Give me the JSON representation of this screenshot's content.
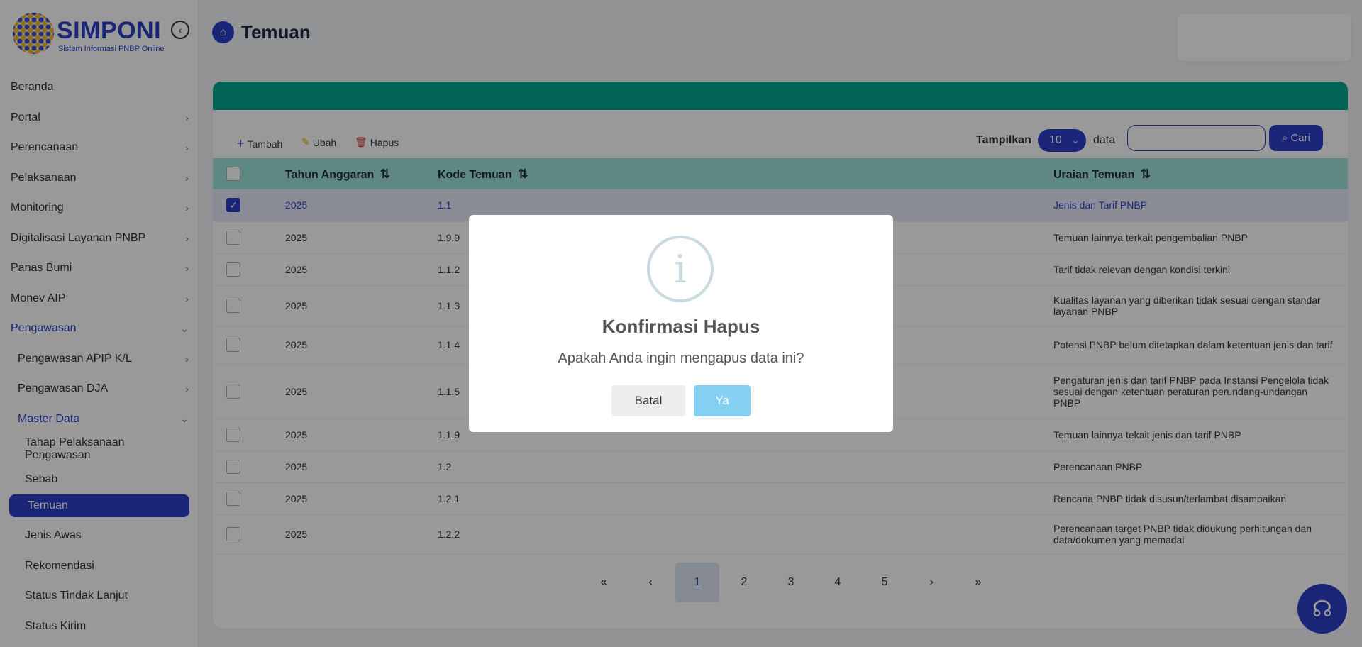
{
  "app": {
    "name": "SIMPONI",
    "subtitle": "Sistem Informasi PNBP Online"
  },
  "sidebar": {
    "items": [
      {
        "label": "Beranda",
        "chevron": ""
      },
      {
        "label": "Portal",
        "chevron": "›"
      },
      {
        "label": "Perencanaan",
        "chevron": "›"
      },
      {
        "label": "Pelaksanaan",
        "chevron": "›"
      },
      {
        "label": "Monitoring",
        "chevron": "›"
      },
      {
        "label": "Digitalisasi Layanan PNBP",
        "chevron": "›"
      },
      {
        "label": "Panas Bumi",
        "chevron": "›"
      },
      {
        "label": "Monev AIP",
        "chevron": "›"
      },
      {
        "label": "Pengawasan",
        "chevron": "⌄"
      },
      {
        "label": "Pengawasan APIP K/L",
        "chevron": "›"
      },
      {
        "label": "Pengawasan DJA",
        "chevron": "›"
      },
      {
        "label": "Master Data",
        "chevron": "⌄"
      },
      {
        "label": "Tahap Pelaksanaan Pengawasan",
        "chevron": ""
      },
      {
        "label": "Sebab",
        "chevron": ""
      },
      {
        "label": "Temuan",
        "chevron": ""
      },
      {
        "label": "Jenis Awas",
        "chevron": ""
      },
      {
        "label": "Rekomendasi",
        "chevron": ""
      },
      {
        "label": "Status Tindak Lanjut",
        "chevron": ""
      },
      {
        "label": "Status Kirim",
        "chevron": ""
      }
    ]
  },
  "page": {
    "title": "Temuan"
  },
  "toolbar": {
    "add_label": "Tambah",
    "edit_label": "Ubah",
    "delete_label": "Hapus",
    "show_label": "Tampilkan",
    "page_size": "10",
    "data_label": "data",
    "search_placeholder": "",
    "search_label": "Cari"
  },
  "table": {
    "columns": [
      "Tahun Anggaran",
      "Kode Temuan",
      "Uraian Temuan"
    ],
    "rows": [
      {
        "year": "2025",
        "code": "1.1",
        "desc": "Jenis dan Tarif PNBP",
        "checked": true
      },
      {
        "year": "2025",
        "code": "1.9.9",
        "desc": "Temuan lainnya terkait pengembalian PNBP",
        "checked": false
      },
      {
        "year": "2025",
        "code": "1.1.2",
        "desc": "Tarif tidak relevan dengan kondisi terkini",
        "checked": false
      },
      {
        "year": "2025",
        "code": "1.1.3",
        "desc": "Kualitas layanan yang diberikan tidak sesuai dengan standar layanan PNBP",
        "checked": false
      },
      {
        "year": "2025",
        "code": "1.1.4",
        "desc": "Potensi PNBP belum ditetapkan dalam ketentuan jenis dan tarif",
        "checked": false
      },
      {
        "year": "2025",
        "code": "1.1.5",
        "desc": "Pengaturan jenis dan tarif PNBP pada Instansi Pengelola tidak sesuai dengan ketentuan peraturan perundang-undangan PNBP",
        "checked": false
      },
      {
        "year": "2025",
        "code": "1.1.9",
        "desc": "Temuan lainnya tekait jenis dan tarif PNBP",
        "checked": false
      },
      {
        "year": "2025",
        "code": "1.2",
        "desc": "Perencanaan PNBP",
        "checked": false
      },
      {
        "year": "2025",
        "code": "1.2.1",
        "desc": "Rencana PNBP tidak disusun/terlambat disampaikan",
        "checked": false
      },
      {
        "year": "2025",
        "code": "1.2.2",
        "desc": "Perencanaan target PNBP tidak didukung perhitungan dan data/dokumen yang memadai",
        "checked": false
      }
    ]
  },
  "pagination": {
    "first": "«",
    "prev": "‹",
    "pages": [
      "1",
      "2",
      "3",
      "4",
      "5"
    ],
    "next": "›",
    "last": "»",
    "current": "1"
  },
  "modal": {
    "icon": "i",
    "title": "Konfirmasi Hapus",
    "message": "Apakah Anda ingin mengapus data ini?",
    "cancel_label": "Batal",
    "confirm_label": "Ya"
  },
  "colors": {
    "primary": "#2c3fc7",
    "card_header": "#00a68e",
    "table_header": "#9de3d8",
    "confirm": "#83d0f2"
  }
}
